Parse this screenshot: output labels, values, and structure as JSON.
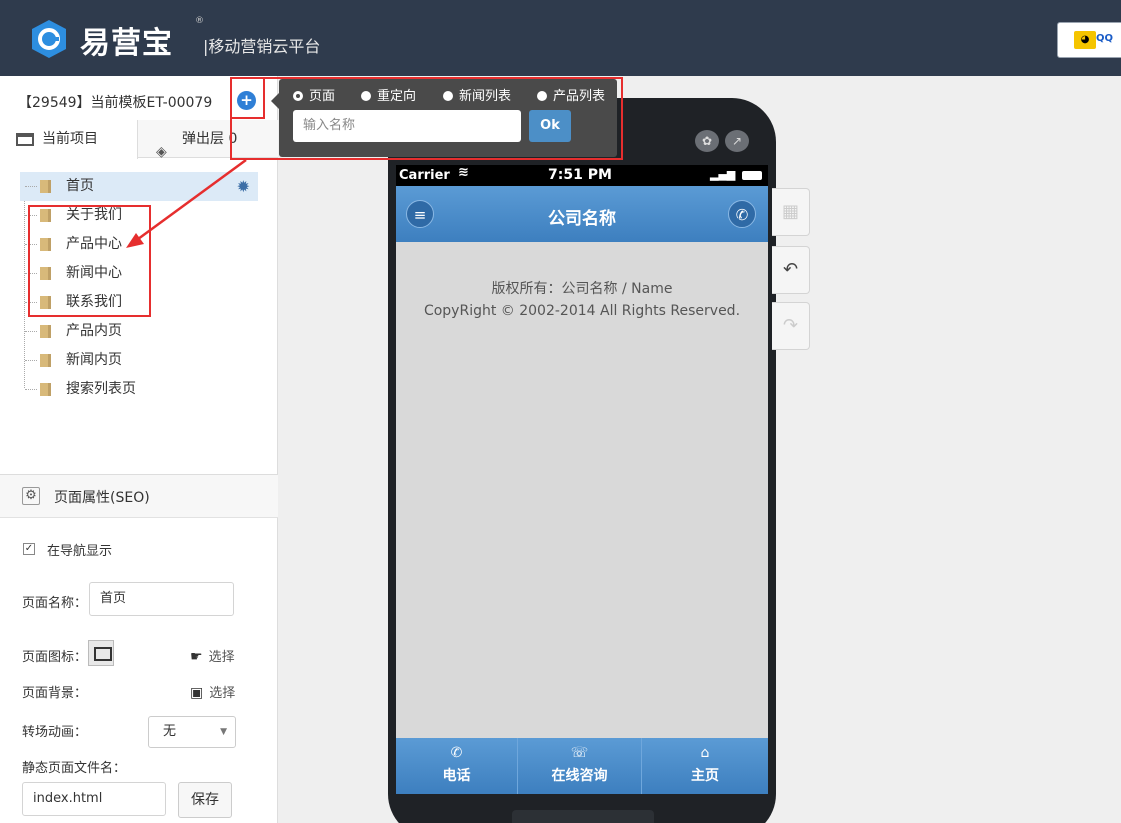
{
  "brand": {
    "name": "易营宝",
    "registered": "®",
    "subtitle": "|移动营销云平台",
    "qq_label": "QQ"
  },
  "project": {
    "title": "【29549】当前模板ET-00079",
    "tabs": [
      {
        "label": "当前项目"
      },
      {
        "label": "弹出层 0"
      }
    ]
  },
  "tree": {
    "items": [
      {
        "label": "首页"
      },
      {
        "label": "关于我们"
      },
      {
        "label": "产品中心"
      },
      {
        "label": "新闻中心"
      },
      {
        "label": "联系我们"
      },
      {
        "label": "产品内页"
      },
      {
        "label": "新闻内页"
      },
      {
        "label": "搜索列表页"
      }
    ]
  },
  "seo": {
    "header": "页面属性(SEO)",
    "show_in_nav_label": "在导航显示",
    "show_in_nav_checked": true,
    "page_name_label": "页面名称：",
    "page_name_value": "首页",
    "page_icon_label": "页面图标：",
    "page_bg_label": "页面背景：",
    "choose_label": "选择",
    "transition_label": "转场动画：",
    "transition_value": "无",
    "static_file_label": "静态页面文件名：",
    "static_file_value": "index.html",
    "save_label": "保存"
  },
  "popover": {
    "radios": [
      {
        "label": "页面",
        "selected": true
      },
      {
        "label": "重定向",
        "selected": false
      },
      {
        "label": "新闻列表",
        "selected": false
      },
      {
        "label": "产品列表",
        "selected": false
      }
    ],
    "name_placeholder": "输入名称",
    "ok_label": "Ok"
  },
  "phone": {
    "carrier": "Carrier",
    "time": "7:51 PM",
    "nav_title": "公司名称",
    "copyright_line1": "版权所有：公司名称 / Name",
    "copyright_line2": "CopyRight © 2002-2014 All Rights Reserved.",
    "bottom_items": [
      {
        "label": "电话",
        "icon": "phone-icon"
      },
      {
        "label": "在线咨询",
        "icon": "chat-icon"
      },
      {
        "label": "主页",
        "icon": "home-icon"
      }
    ]
  },
  "colors": {
    "topbar": "#2f3b4d",
    "accent_blue": "#3d7fbf",
    "highlight_red": "#e62e2e",
    "popover_bg": "#4a4a4a"
  }
}
